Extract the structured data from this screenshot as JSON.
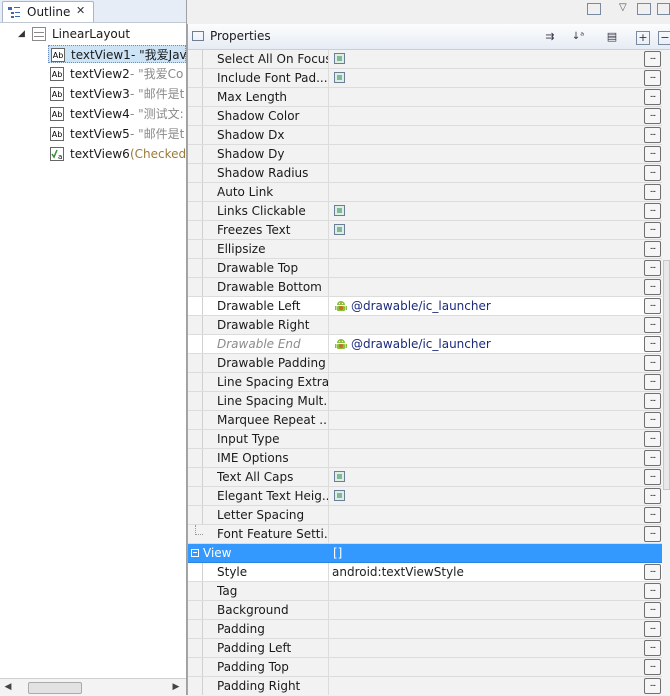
{
  "outline": {
    "tab_label": "Outline",
    "tree": {
      "root": "LinearLayout",
      "nodes": [
        {
          "name": "textView1",
          "detail": " - \"我爱Jav",
          "icon": "Ab",
          "selected": true
        },
        {
          "name": "textView2",
          "detail": " - \"我爱Co",
          "icon": "Ab"
        },
        {
          "name": "textView3",
          "detail": " - \"邮件是t",
          "icon": "Ab"
        },
        {
          "name": "textView4",
          "detail": " - \"测试文:",
          "icon": "Ab"
        },
        {
          "name": "textView5",
          "detail": " - \"邮件是t",
          "icon": "Ab"
        },
        {
          "name": "textView6",
          "detail": " (Checked",
          "icon": "checked"
        }
      ]
    }
  },
  "properties": {
    "title": "Properties",
    "toolbar_icons": [
      "show-advanced-icon",
      "sort-az-icon",
      "restore-default-icon",
      "expand-all-icon",
      "collapse-all-icon"
    ],
    "rows": [
      {
        "name": "Select All On Focus",
        "checkbox": true
      },
      {
        "name": "Include Font Pad...",
        "checkbox": true
      },
      {
        "name": "Max Length"
      },
      {
        "name": "Shadow Color"
      },
      {
        "name": "Shadow Dx"
      },
      {
        "name": "Shadow Dy"
      },
      {
        "name": "Shadow Radius"
      },
      {
        "name": "Auto Link"
      },
      {
        "name": "Links Clickable",
        "checkbox": true
      },
      {
        "name": "Freezes Text",
        "checkbox": true
      },
      {
        "name": "Ellipsize"
      },
      {
        "name": "Drawable Top"
      },
      {
        "name": "Drawable Bottom"
      },
      {
        "name": "Drawable Left",
        "value": "@drawable/ic_launcher",
        "value_icon": "android-icon"
      },
      {
        "name": "Drawable Right"
      },
      {
        "name": "Drawable End",
        "value": "@drawable/ic_launcher",
        "value_icon": "android-icon",
        "italic": true
      },
      {
        "name": "Drawable Padding"
      },
      {
        "name": "Line Spacing Extra"
      },
      {
        "name": "Line Spacing Mult..."
      },
      {
        "name": "Marquee Repeat ..."
      },
      {
        "name": "Input Type"
      },
      {
        "name": "IME Options"
      },
      {
        "name": "Text All Caps",
        "checkbox": true
      },
      {
        "name": "Elegant Text Heig...",
        "checkbox": true
      },
      {
        "name": "Letter Spacing"
      },
      {
        "name": "Font Feature Setti..."
      }
    ],
    "category": {
      "name": "View",
      "value": "[]"
    },
    "view_rows": [
      {
        "name": "Style",
        "value": "android:textViewStyle"
      },
      {
        "name": "Tag"
      },
      {
        "name": "Background"
      },
      {
        "name": "Padding"
      },
      {
        "name": "Padding Left"
      },
      {
        "name": "Padding Top"
      },
      {
        "name": "Padding Right"
      }
    ],
    "ellipsis_label": "...",
    "colors": {
      "selection": "#3399ff",
      "checkbox_fill": "#7fb99a",
      "link_value": "#1b2a7a"
    }
  },
  "scroll_arrows": {
    "left": "◀",
    "right": "▶"
  }
}
